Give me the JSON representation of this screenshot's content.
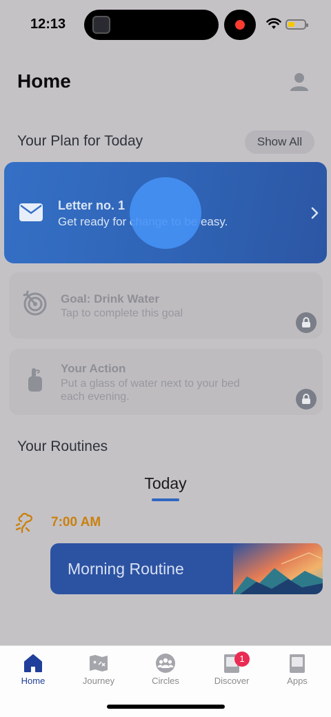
{
  "status": {
    "time": "12:13"
  },
  "header": {
    "title": "Home"
  },
  "plan": {
    "section_title": "Your Plan for Today",
    "show_all": "Show All",
    "letter": {
      "title": "Letter no. 1",
      "subtitle": "Get ready for change to be easy."
    },
    "goal": {
      "title": "Goal: Drink Water",
      "subtitle": "Tap to complete this goal"
    },
    "action": {
      "title": "Your Action",
      "subtitle_line1": "Put a glass of water next to your bed",
      "subtitle_line2": "each evening."
    }
  },
  "routines": {
    "section_title": "Your Routines",
    "tab": "Today",
    "time": "7:00 AM",
    "card_label": "Morning Routine"
  },
  "tabbar": {
    "items": [
      {
        "label": "Home",
        "icon": "home-icon",
        "active": true
      },
      {
        "label": "Journey",
        "icon": "map-icon"
      },
      {
        "label": "Circles",
        "icon": "people-icon"
      },
      {
        "label": "Discover",
        "icon": "discover-icon",
        "badge": "1"
      },
      {
        "label": "Apps",
        "icon": "apps-icon"
      }
    ]
  },
  "colors": {
    "accent": "#2f66c0",
    "letter_card": "#3470c6",
    "routine_time": "#c9810e",
    "badge": "#ea2b53"
  }
}
